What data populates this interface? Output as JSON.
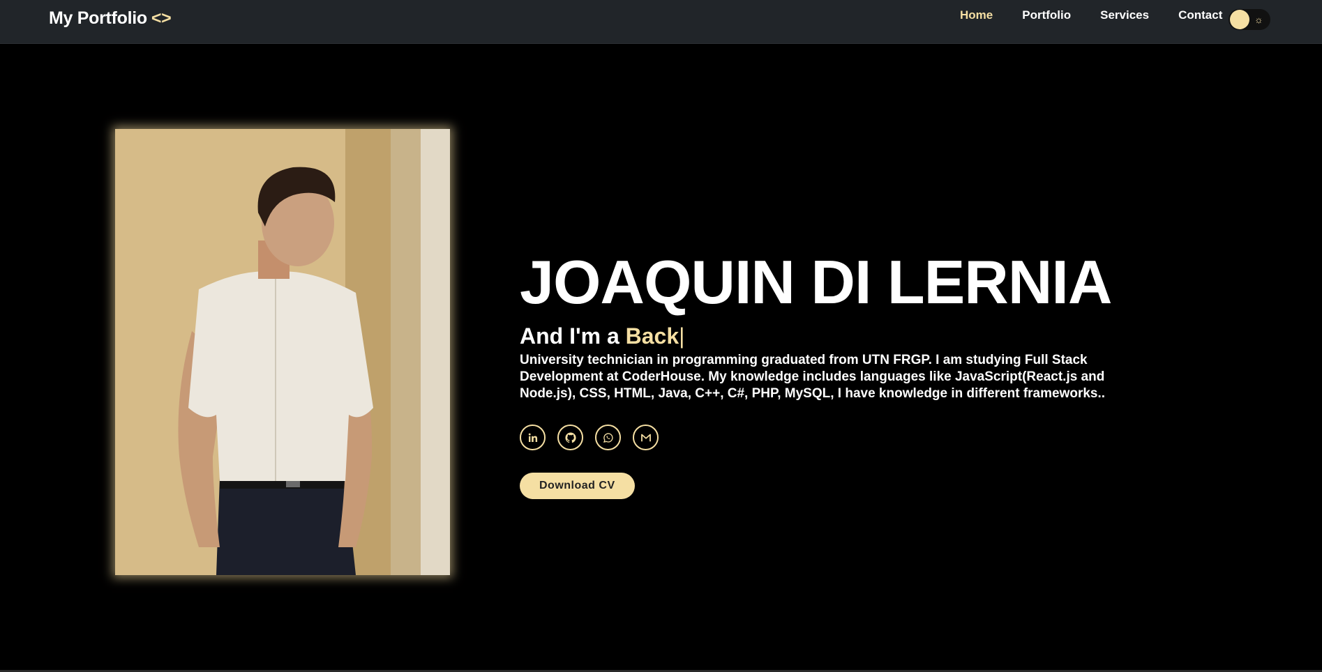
{
  "navbar": {
    "brand": "My Portfolio",
    "brand_code": "<>",
    "links": [
      "Home",
      "Portfolio",
      "Services",
      "Contact"
    ],
    "active": "Home",
    "theme_toggle_icon": "sun-icon"
  },
  "hero": {
    "name": "JOAQUIN DI LERNIA",
    "role_prefix": "And I'm a",
    "role_typed": "Back",
    "cursor": "|",
    "description": "University technician in programming graduated from UTN FRGP. I am studying Full Stack Development at CoderHouse. My knowledge includes languages like JavaScript(React.js and Node.js), CSS, HTML, Java, C++, C#, PHP, MySQL, I have knowledge in different frameworks..",
    "socials": [
      "linkedin-icon",
      "github-icon",
      "whatsapp-icon",
      "gmail-icon"
    ],
    "cv_button": "Download CV"
  },
  "colors": {
    "accent": "#f5dfa3",
    "navbar_bg": "#212529",
    "page_bg": "#000000"
  }
}
